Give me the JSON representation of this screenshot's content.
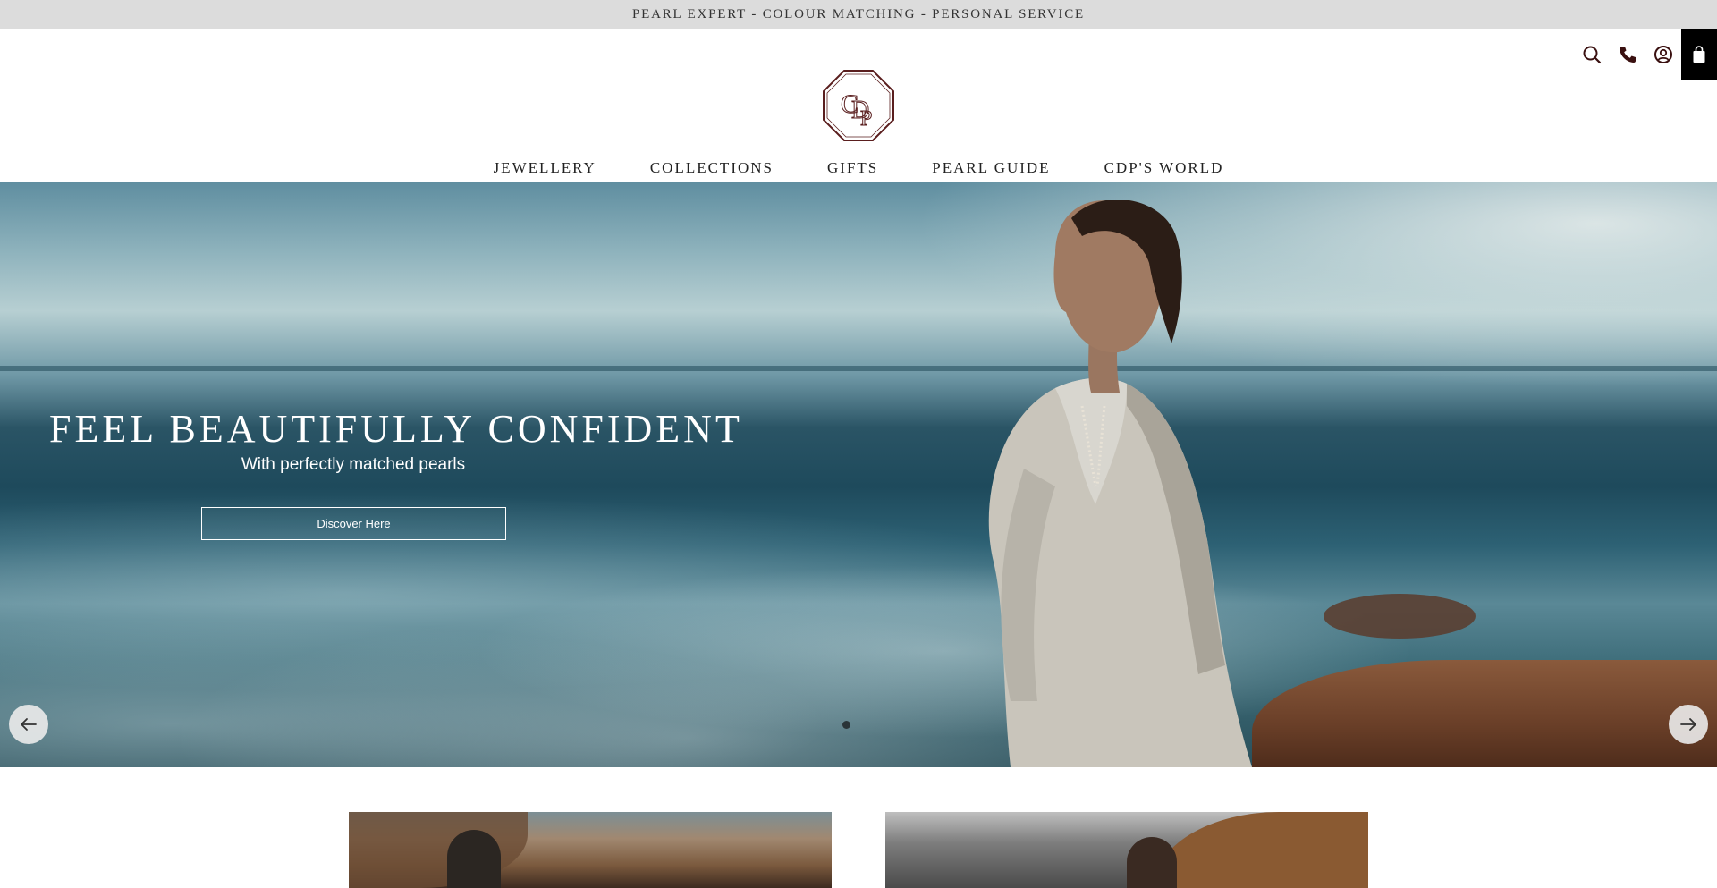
{
  "announcement": {
    "text": "PEARL EXPERT - COLOUR MATCHING - PERSONAL SERVICE"
  },
  "header": {
    "logo_text": "CDP",
    "icons": [
      "search-icon",
      "phone-icon",
      "account-icon",
      "bag-icon"
    ]
  },
  "nav": {
    "items": [
      {
        "label": "JEWELLERY"
      },
      {
        "label": "COLLECTIONS"
      },
      {
        "label": "GIFTS"
      },
      {
        "label": "PEARL GUIDE"
      },
      {
        "label": "CDP'S WORLD"
      }
    ]
  },
  "hero": {
    "title": "FEEL BEAUTIFULLY CONFIDENT",
    "subtitle": "With perfectly matched pearls",
    "button_label": "Discover Here",
    "slide_count": 1,
    "active_slide": 1
  },
  "colors": {
    "announcement_bg": "#dcdcdc",
    "logo_color": "#5a1e1e",
    "bag_bg": "#000000",
    "hero_text": "#ffffff"
  }
}
